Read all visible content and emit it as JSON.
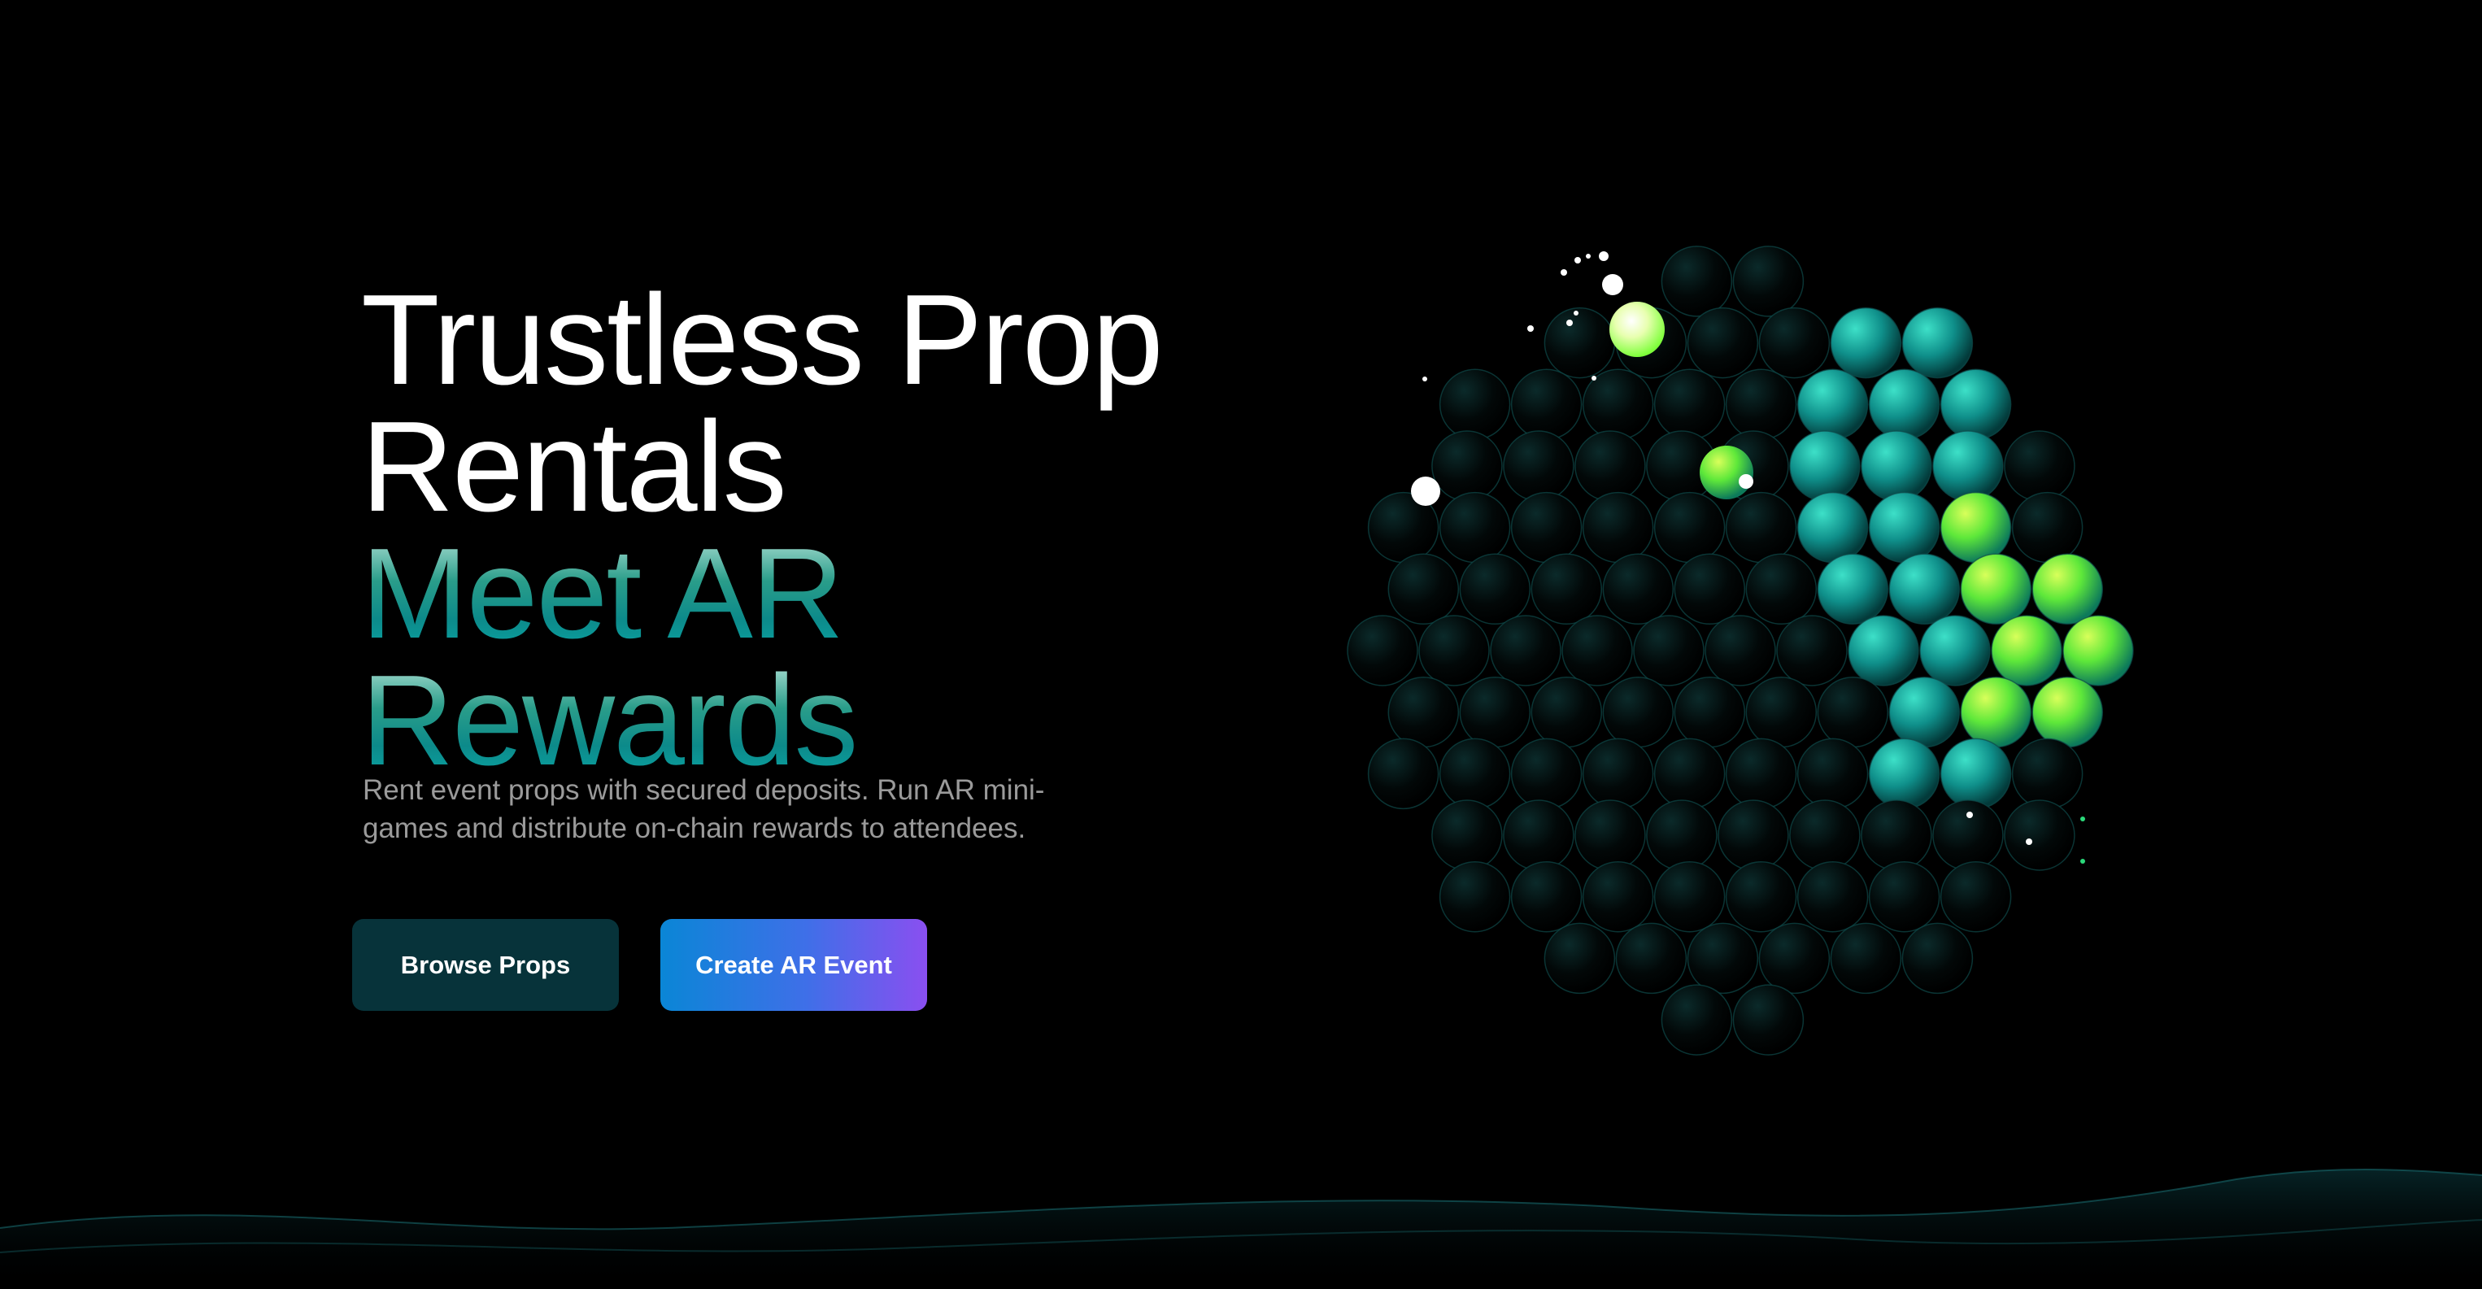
{
  "hero": {
    "title_line1": "Trustless Prop",
    "title_line2": "Rentals",
    "accent_line1": "Meet AR",
    "accent_line2": "Rewards",
    "subtitle": "Rent event props with secured deposits. Run AR mini-games and distribute on-chain rewards to attendees."
  },
  "actions": {
    "browse_label": "Browse Props",
    "create_label": "Create AR Event"
  },
  "colors": {
    "background": "#000000",
    "accent_teal": "#0aa6a6",
    "accent_green": "#7dff3a",
    "button_dark": "#07333a",
    "button_gradient_start": "#0a86d6",
    "button_gradient_end": "#8a4ff0"
  },
  "decorations": {
    "orb": "sphere-of-spheres-graphic",
    "wave": "bottom-wave-graphic"
  }
}
